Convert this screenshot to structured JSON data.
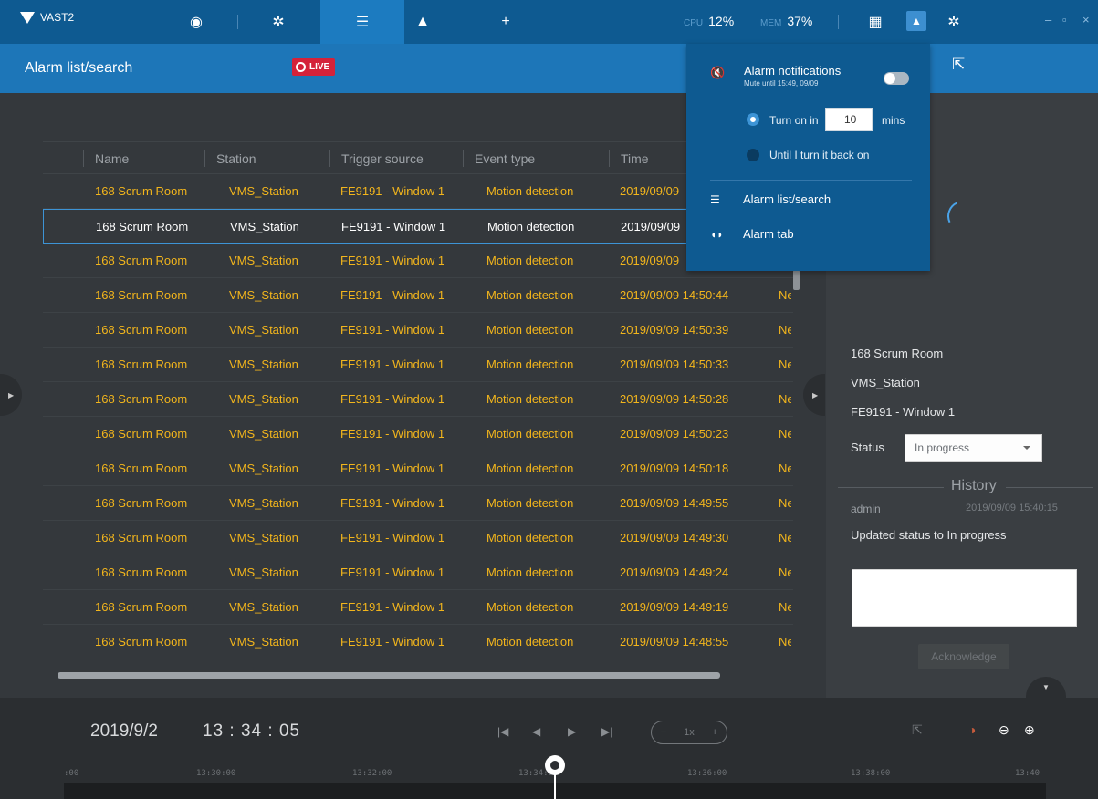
{
  "app": {
    "name": "VAST2"
  },
  "system": {
    "cpu_label": "CPU",
    "cpu_value": "12%",
    "mem_label": "MEM",
    "mem_value": "37%"
  },
  "topbar": {
    "icons": [
      "eye-icon",
      "gear-icon",
      "alarm-list-icon",
      "bell-icon",
      "plus-icon"
    ],
    "right_icons": [
      "grid-icon",
      "bell-icon",
      "gear-icon"
    ],
    "window_controls": [
      "–",
      "▫",
      "×"
    ]
  },
  "page": {
    "title": "Alarm list/search",
    "live_label": "LIVE"
  },
  "table": {
    "columns": [
      "Name",
      "Station",
      "Trigger source",
      "Event type",
      "Time"
    ],
    "rows": [
      {
        "name": "168 Scrum Room",
        "station": "VMS_Station",
        "trigger": "FE9191 - Window 1",
        "event": "Motion detection",
        "time": "2019/09/09",
        "extra": "",
        "selected": false
      },
      {
        "name": "168 Scrum Room",
        "station": "VMS_Station",
        "trigger": "FE9191 - Window 1",
        "event": "Motion detection",
        "time": "2019/09/09",
        "extra": "",
        "selected": true
      },
      {
        "name": "168 Scrum Room",
        "station": "VMS_Station",
        "trigger": "FE9191 - Window 1",
        "event": "Motion detection",
        "time": "2019/09/09",
        "extra": "",
        "selected": false
      },
      {
        "name": "168 Scrum Room",
        "station": "VMS_Station",
        "trigger": "FE9191 - Window 1",
        "event": "Motion detection",
        "time": "2019/09/09 14:50:44",
        "extra": "Ne",
        "selected": false
      },
      {
        "name": "168 Scrum Room",
        "station": "VMS_Station",
        "trigger": "FE9191 - Window 1",
        "event": "Motion detection",
        "time": "2019/09/09 14:50:39",
        "extra": "Ne",
        "selected": false
      },
      {
        "name": "168 Scrum Room",
        "station": "VMS_Station",
        "trigger": "FE9191 - Window 1",
        "event": "Motion detection",
        "time": "2019/09/09 14:50:33",
        "extra": "Ne",
        "selected": false
      },
      {
        "name": "168 Scrum Room",
        "station": "VMS_Station",
        "trigger": "FE9191 - Window 1",
        "event": "Motion detection",
        "time": "2019/09/09 14:50:28",
        "extra": "Ne",
        "selected": false
      },
      {
        "name": "168 Scrum Room",
        "station": "VMS_Station",
        "trigger": "FE9191 - Window 1",
        "event": "Motion detection",
        "time": "2019/09/09 14:50:23",
        "extra": "Ne",
        "selected": false
      },
      {
        "name": "168 Scrum Room",
        "station": "VMS_Station",
        "trigger": "FE9191 - Window 1",
        "event": "Motion detection",
        "time": "2019/09/09 14:50:18",
        "extra": "Ne",
        "selected": false
      },
      {
        "name": "168 Scrum Room",
        "station": "VMS_Station",
        "trigger": "FE9191 - Window 1",
        "event": "Motion detection",
        "time": "2019/09/09 14:49:55",
        "extra": "Ne",
        "selected": false
      },
      {
        "name": "168 Scrum Room",
        "station": "VMS_Station",
        "trigger": "FE9191 - Window 1",
        "event": "Motion detection",
        "time": "2019/09/09 14:49:30",
        "extra": "Ne",
        "selected": false
      },
      {
        "name": "168 Scrum Room",
        "station": "VMS_Station",
        "trigger": "FE9191 - Window 1",
        "event": "Motion detection",
        "time": "2019/09/09 14:49:24",
        "extra": "Ne",
        "selected": false
      },
      {
        "name": "168 Scrum Room",
        "station": "VMS_Station",
        "trigger": "FE9191 - Window 1",
        "event": "Motion detection",
        "time": "2019/09/09 14:49:19",
        "extra": "Ne",
        "selected": false
      },
      {
        "name": "168 Scrum Room",
        "station": "VMS_Station",
        "trigger": "FE9191 - Window 1",
        "event": "Motion detection",
        "time": "2019/09/09 14:48:55",
        "extra": "Ne",
        "selected": false
      }
    ]
  },
  "detail": {
    "name": "168 Scrum Room",
    "station": "VMS_Station",
    "source": "FE9191 - Window 1",
    "status_label": "Status",
    "status_value": "In progress",
    "history_title": "History",
    "history_user": "admin",
    "history_time": "2019/09/09 15:40:15",
    "history_message": "Updated status to In progress",
    "ack_label": "Acknowledge"
  },
  "notifications": {
    "title": "Alarm notifications",
    "subtitle": "Mute until 15:49, 09/09",
    "turn_on_label": "Turn on in",
    "minutes_value": "10",
    "minutes_unit": "mins",
    "until_label": "Until I turn it back on",
    "link_alarm_list": "Alarm list/search",
    "link_alarm_tab": "Alarm tab"
  },
  "playback": {
    "date": "2019/9/2",
    "time": "13 : 34 : 05",
    "speed": "1x",
    "speed_minus": "−",
    "speed_plus": "+"
  },
  "timeline": {
    "ticks": [
      ":00",
      "13:30:00",
      "13:32:00",
      "13:34:00",
      "13:36:00",
      "13:38:00",
      "13:40"
    ]
  }
}
